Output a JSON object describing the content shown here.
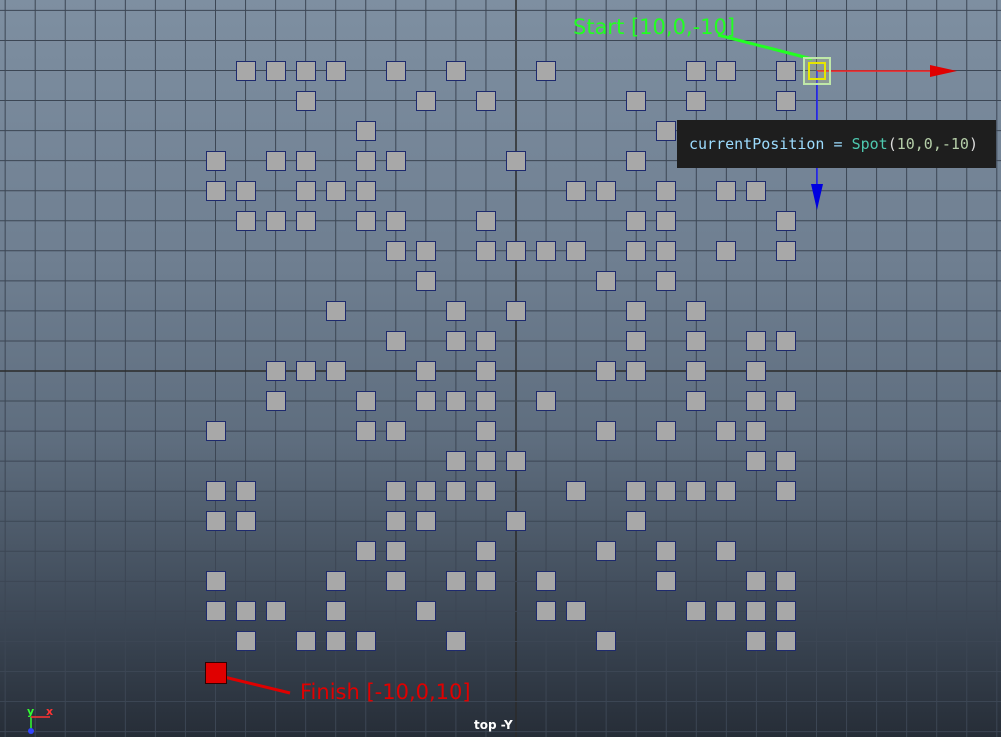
{
  "viewport": {
    "view_label": "top -Y",
    "axis_y_label": "y",
    "axis_x_label": "x"
  },
  "start": {
    "label": "Start [10,0,-10]"
  },
  "finish": {
    "label": "Finish [-10,0,10]"
  },
  "tooltip": {
    "var_name": "currentPosition",
    "operator": "=",
    "class_name": "Spot",
    "open": "(",
    "args": "10,0,-10",
    "close": ")"
  },
  "colors": {
    "tile_fill": "#a8a8a8",
    "tile_border": "#1e2a6e",
    "start_color": "#22ff22",
    "finish_color": "#e00000",
    "x_axis": "#ff0000",
    "z_axis": "#0000ff"
  },
  "tiles": [
    [
      -9,
      -10
    ],
    [
      -8,
      -10
    ],
    [
      -7,
      -10
    ],
    [
      -6,
      -10
    ],
    [
      -4,
      -10
    ],
    [
      -2,
      -10
    ],
    [
      1,
      -10
    ],
    [
      6,
      -10
    ],
    [
      7,
      -10
    ],
    [
      9,
      -10
    ],
    [
      -7,
      -9
    ],
    [
      -3,
      -9
    ],
    [
      -1,
      -9
    ],
    [
      4,
      -9
    ],
    [
      6,
      -9
    ],
    [
      9,
      -9
    ],
    [
      -5,
      -8
    ],
    [
      5,
      -8
    ],
    [
      -10,
      -7
    ],
    [
      -8,
      -7
    ],
    [
      -7,
      -7
    ],
    [
      -5,
      -7
    ],
    [
      -4,
      -7
    ],
    [
      0,
      -7
    ],
    [
      4,
      -7
    ],
    [
      -10,
      -6
    ],
    [
      -9,
      -6
    ],
    [
      -7,
      -6
    ],
    [
      -6,
      -6
    ],
    [
      -5,
      -6
    ],
    [
      2,
      -6
    ],
    [
      3,
      -6
    ],
    [
      5,
      -6
    ],
    [
      7,
      -6
    ],
    [
      8,
      -6
    ],
    [
      -9,
      -5
    ],
    [
      -8,
      -5
    ],
    [
      -7,
      -5
    ],
    [
      -5,
      -5
    ],
    [
      -4,
      -5
    ],
    [
      -1,
      -5
    ],
    [
      4,
      -5
    ],
    [
      5,
      -5
    ],
    [
      9,
      -5
    ],
    [
      -4,
      -4
    ],
    [
      -3,
      -4
    ],
    [
      -1,
      -4
    ],
    [
      0,
      -4
    ],
    [
      1,
      -4
    ],
    [
      2,
      -4
    ],
    [
      4,
      -4
    ],
    [
      5,
      -4
    ],
    [
      7,
      -4
    ],
    [
      9,
      -4
    ],
    [
      -3,
      -3
    ],
    [
      3,
      -3
    ],
    [
      5,
      -3
    ],
    [
      -6,
      -2
    ],
    [
      -2,
      -2
    ],
    [
      0,
      -2
    ],
    [
      4,
      -2
    ],
    [
      6,
      -2
    ],
    [
      -4,
      -1
    ],
    [
      -2,
      -1
    ],
    [
      -1,
      -1
    ],
    [
      4,
      -1
    ],
    [
      6,
      -1
    ],
    [
      8,
      -1
    ],
    [
      9,
      -1
    ],
    [
      -8,
      0
    ],
    [
      -7,
      0
    ],
    [
      -6,
      0
    ],
    [
      -3,
      0
    ],
    [
      -1,
      0
    ],
    [
      3,
      0
    ],
    [
      4,
      0
    ],
    [
      6,
      0
    ],
    [
      8,
      0
    ],
    [
      -8,
      1
    ],
    [
      -5,
      1
    ],
    [
      -3,
      1
    ],
    [
      -2,
      1
    ],
    [
      -1,
      1
    ],
    [
      1,
      1
    ],
    [
      6,
      1
    ],
    [
      8,
      1
    ],
    [
      9,
      1
    ],
    [
      -10,
      2
    ],
    [
      -5,
      2
    ],
    [
      -4,
      2
    ],
    [
      -1,
      2
    ],
    [
      3,
      2
    ],
    [
      5,
      2
    ],
    [
      7,
      2
    ],
    [
      8,
      2
    ],
    [
      -2,
      3
    ],
    [
      -1,
      3
    ],
    [
      0,
      3
    ],
    [
      8,
      3
    ],
    [
      9,
      3
    ],
    [
      -10,
      4
    ],
    [
      -9,
      4
    ],
    [
      -4,
      4
    ],
    [
      -3,
      4
    ],
    [
      -2,
      4
    ],
    [
      -1,
      4
    ],
    [
      2,
      4
    ],
    [
      4,
      4
    ],
    [
      5,
      4
    ],
    [
      6,
      4
    ],
    [
      7,
      4
    ],
    [
      9,
      4
    ],
    [
      -10,
      5
    ],
    [
      -9,
      5
    ],
    [
      -4,
      5
    ],
    [
      -3,
      5
    ],
    [
      0,
      5
    ],
    [
      4,
      5
    ],
    [
      -5,
      6
    ],
    [
      -4,
      6
    ],
    [
      -1,
      6
    ],
    [
      3,
      6
    ],
    [
      5,
      6
    ],
    [
      7,
      6
    ],
    [
      -10,
      7
    ],
    [
      -6,
      7
    ],
    [
      -4,
      7
    ],
    [
      -2,
      7
    ],
    [
      -1,
      7
    ],
    [
      1,
      7
    ],
    [
      5,
      7
    ],
    [
      8,
      7
    ],
    [
      9,
      7
    ],
    [
      -10,
      8
    ],
    [
      -9,
      8
    ],
    [
      -8,
      8
    ],
    [
      -6,
      8
    ],
    [
      -3,
      8
    ],
    [
      1,
      8
    ],
    [
      2,
      8
    ],
    [
      6,
      8
    ],
    [
      7,
      8
    ],
    [
      8,
      8
    ],
    [
      9,
      8
    ],
    [
      -9,
      9
    ],
    [
      -7,
      9
    ],
    [
      -6,
      9
    ],
    [
      -5,
      9
    ],
    [
      -2,
      9
    ],
    [
      3,
      9
    ],
    [
      8,
      9
    ],
    [
      9,
      9
    ]
  ],
  "start_cell": [
    10,
    -10
  ],
  "finish_cell": [
    -10,
    10
  ]
}
